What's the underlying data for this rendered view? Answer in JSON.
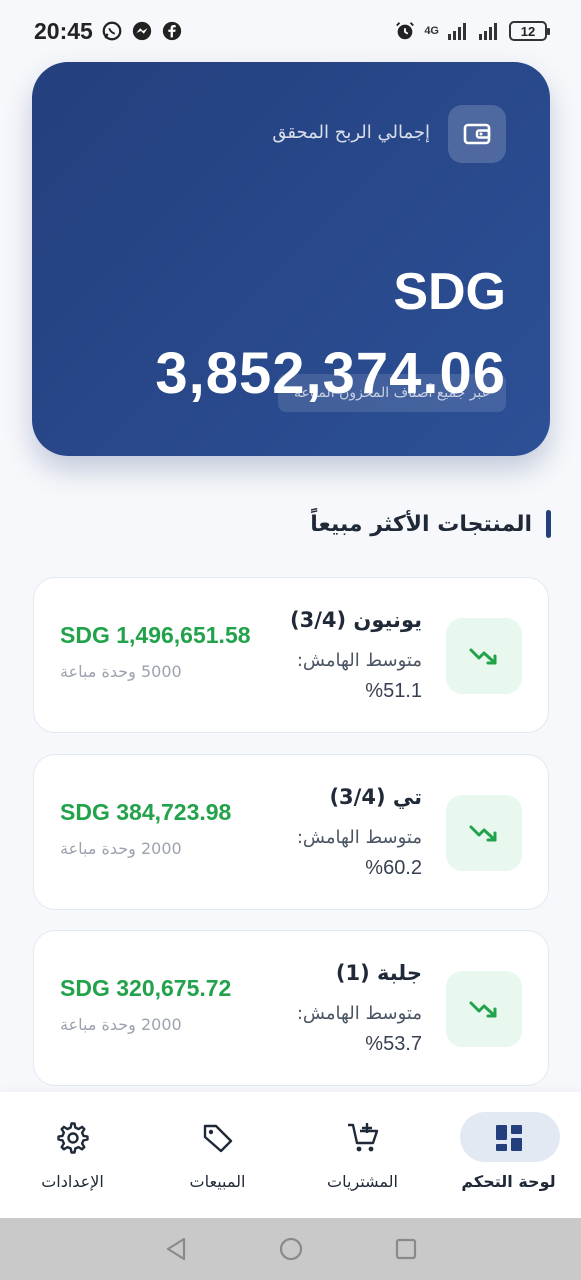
{
  "status_bar": {
    "time": "20:45",
    "network": "4G",
    "battery": "12",
    "icons": [
      "whatsapp-icon",
      "messenger-icon",
      "facebook-icon",
      "alarm-icon",
      "signal-icon",
      "battery-icon"
    ]
  },
  "summary": {
    "label": "إجمالي الربح المحقق",
    "currency": "SDG",
    "amount": "3,852,374.06",
    "note": "عبر جميع أصناف المخزون المباعة",
    "icon": "wallet-icon"
  },
  "section": {
    "title": "المنتجات الأكثر مبيعاً"
  },
  "products": [
    {
      "name": "يونيون (3/4)",
      "margin_label": "متوسط الهامش:",
      "margin_value": "%51.1",
      "revenue": "SDG 1,496,651.58",
      "units": "5000 وحدة مباعة",
      "icon": "trending-up-icon"
    },
    {
      "name": "تي (3/4)",
      "margin_label": "متوسط الهامش:",
      "margin_value": "%60.2",
      "revenue": "SDG 384,723.98",
      "units": "2000 وحدة مباعة",
      "icon": "trending-up-icon"
    },
    {
      "name": "جلبة (1)",
      "margin_label": "متوسط الهامش:",
      "margin_value": "%53.7",
      "revenue": "SDG 320,675.72",
      "units": "2000 وحدة مباعة",
      "icon": "trending-up-icon"
    }
  ],
  "nav": {
    "items": [
      {
        "label": "لوحة التحكم",
        "icon": "dashboard-icon",
        "active": true
      },
      {
        "label": "المشتريات",
        "icon": "cart-add-icon",
        "active": false
      },
      {
        "label": "المبيعات",
        "icon": "tag-icon",
        "active": false
      },
      {
        "label": "الإعدادات",
        "icon": "gear-icon",
        "active": false
      }
    ]
  },
  "colors": {
    "card_gradient_start": "#243f7d",
    "card_gradient_end": "#2c5096",
    "revenue_green": "#22a24a",
    "trend_bg": "#e9f8ee",
    "nav_active_pill": "#e3e9f3"
  }
}
